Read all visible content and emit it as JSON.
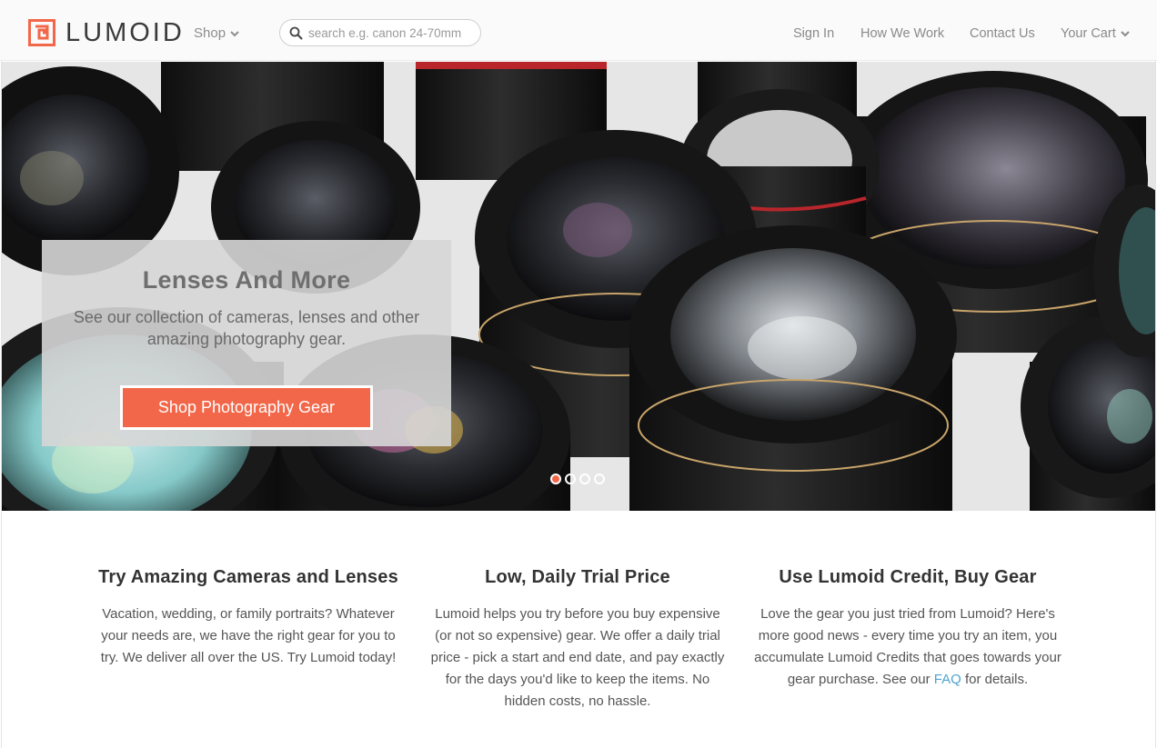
{
  "header": {
    "logo_text": "LUMOID",
    "shop_label": "Shop",
    "search_placeholder": "search e.g. canon 24-70mm",
    "nav": {
      "sign_in": "Sign In",
      "how_we_work": "How We Work",
      "contact_us": "Contact Us",
      "your_cart": "Your Cart"
    }
  },
  "hero": {
    "title": "Lenses And More",
    "text": "See our collection of cameras, lenses and other amazing photography gear.",
    "button_label": "Shop Photography Gear",
    "slides_total": 4,
    "active_slide": 1
  },
  "features": [
    {
      "title": "Try Amazing Cameras and Lenses",
      "text": "Vacation, wedding, or family portraits? Whatever your needs are, we have the right gear for you to try. We deliver all over the US. Try Lumoid today!"
    },
    {
      "title": "Low, Daily Trial Price",
      "text": "Lumoid helps you try before you buy expensive (or not so expensive) gear. We offer a daily trial price - pick a start and end date, and pay exactly for the days you'd like to keep the items. No hidden costs, no hassle."
    },
    {
      "title": "Use Lumoid Credit, Buy Gear",
      "text_before": "Love the gear you just tried from Lumoid? Here's more good news - every time you try an item, you accumulate Lumoid Credits that goes towards your gear purchase. See our ",
      "link": "FAQ",
      "text_after": " for details."
    }
  ],
  "colors": {
    "accent": "#f26749",
    "link": "#4fa3cf",
    "nav_text": "#8a8a8a"
  },
  "icons": {
    "logo": "lumoid-logo-icon",
    "shop_chevron": "chevron-down-icon",
    "search": "search-icon",
    "cart_chevron": "chevron-down-icon"
  }
}
